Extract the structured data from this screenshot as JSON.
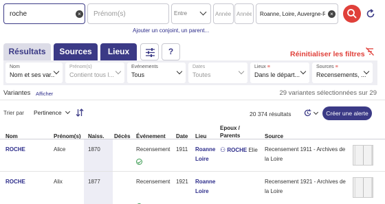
{
  "search": {
    "name_value": "roche",
    "first_name_placeholder": "Prénom(s)",
    "date_mode": "Entre",
    "year_from_placeholder": "Année",
    "year_to_placeholder": "Année",
    "place_value": "Roanne, Loire, Auvergne-Rhône-Alpes",
    "add_spouse_link": "Ajouter un conjoint, un parent..."
  },
  "tabs": [
    {
      "label": "Résultats"
    },
    {
      "label": "Sources"
    },
    {
      "label": "Lieux"
    }
  ],
  "reset_filters": "Réinitialiser les filtres",
  "filters": [
    {
      "label": "Nom",
      "value": "Nom et ses var..."
    },
    {
      "label": "Prénom(s)",
      "value": "Contient tous l..."
    },
    {
      "label": "Evénements",
      "value": "Tous"
    },
    {
      "label": "Dates",
      "value": "Toutes"
    },
    {
      "label": "Lieux",
      "value": "Dans le départ..."
    },
    {
      "label": "Sources",
      "value": "Recensements, ..."
    }
  ],
  "variants": {
    "label": "Variantes",
    "show_link": "Afficher",
    "selected_text": "29 variantes sélectionnées sur 29"
  },
  "sort": {
    "label": "Trier par",
    "value": "Pertinence"
  },
  "results_count": "20 374 résultats",
  "create_alert": "Créer une alerte",
  "table": {
    "headers": {
      "nom": "Nom",
      "prenoms": "Prénom(s)",
      "naiss": "Naiss.",
      "deces": "Décès",
      "evenement": "Événement",
      "date": "Date",
      "lieu": "Lieu",
      "epoux_1": "Epoux /",
      "epoux_2": "Parents",
      "source": "Source"
    },
    "rows": [
      {
        "nom": "ROCHE",
        "prenom": "Alice",
        "naiss": "1870",
        "deces": "",
        "evenement": "Recensement",
        "date": "1911",
        "lieu_1": "Roanne",
        "lieu_2": "Loire",
        "parent_name": "ROCHE",
        "parent_first": "Elie",
        "source_1": "Recensement 1911 - Archives de",
        "source_2": "la Loire"
      },
      {
        "nom": "ROCHE",
        "prenom": "Alix",
        "naiss": "1877",
        "deces": "",
        "evenement": "Recensement",
        "date": "1921",
        "lieu_1": "Roanne",
        "lieu_2": "Loire",
        "parent_name": "",
        "parent_first": "",
        "source_1": "Recensement 1921 - Archives de",
        "source_2": "la Loire"
      }
    ]
  },
  "colors": {
    "accent_red": "#e0403a",
    "primary_purple": "#3b3a86",
    "link_blue": "#2c2c8a",
    "filter_bar_bg": "#eeeef3",
    "highlight_col": "#ededf5"
  }
}
